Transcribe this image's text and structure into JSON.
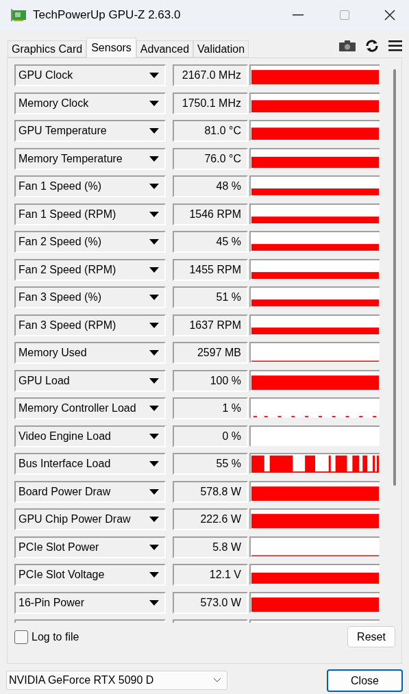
{
  "window": {
    "title": "TechPowerUp GPU-Z 2.63.0"
  },
  "tabs": [
    {
      "label": "Graphics Card",
      "selected": false
    },
    {
      "label": "Sensors",
      "selected": true
    },
    {
      "label": "Advanced",
      "selected": false
    },
    {
      "label": "Validation",
      "selected": false
    }
  ],
  "sensors": [
    {
      "name": "GPU Clock",
      "value": "2167.0 MHz",
      "kind": "full"
    },
    {
      "name": "Memory Clock",
      "value": "1750.1 MHz",
      "kind": "high"
    },
    {
      "name": "GPU Temperature",
      "value": "81.0 °C",
      "kind": "high"
    },
    {
      "name": "Memory Temperature",
      "value": "76.0 °C",
      "kind": "medium"
    },
    {
      "name": "Fan 1 Speed (%)",
      "value": "48 %",
      "kind": "low"
    },
    {
      "name": "Fan 1 Speed (RPM)",
      "value": "1546 RPM",
      "kind": "low"
    },
    {
      "name": "Fan 2 Speed (%)",
      "value": "45 %",
      "kind": "low"
    },
    {
      "name": "Fan 2 Speed (RPM)",
      "value": "1455 RPM",
      "kind": "low"
    },
    {
      "name": "Fan 3 Speed (%)",
      "value": "51 %",
      "kind": "low"
    },
    {
      "name": "Fan 3 Speed (RPM)",
      "value": "1637 RPM",
      "kind": "low"
    },
    {
      "name": "Memory Used",
      "value": "2597 MB",
      "kind": "line"
    },
    {
      "name": "GPU Load",
      "value": "100 %",
      "kind": "full"
    },
    {
      "name": "Memory Controller Load",
      "value": "1 %",
      "kind": "dots"
    },
    {
      "name": "Video Engine Load",
      "value": "0 %",
      "kind": "empty"
    },
    {
      "name": "Bus Interface Load",
      "value": "55 %",
      "kind": "spiky"
    },
    {
      "name": "Board Power Draw",
      "value": "578.8 W",
      "kind": "full"
    },
    {
      "name": "GPU Chip Power Draw",
      "value": "222.6 W",
      "kind": "full"
    },
    {
      "name": "PCIe Slot Power",
      "value": "5.8 W",
      "kind": "line"
    },
    {
      "name": "PCIe Slot Voltage",
      "value": "12.1 V",
      "kind": "medium"
    },
    {
      "name": "16-Pin Power",
      "value": "573.0 W",
      "kind": "full"
    }
  ],
  "log_to_file": {
    "label": "Log to file",
    "checked": false
  },
  "reset_button": "Reset",
  "gpu_select": {
    "value": "NVIDIA GeForce RTX 5090 D"
  },
  "close_button": "Close"
}
